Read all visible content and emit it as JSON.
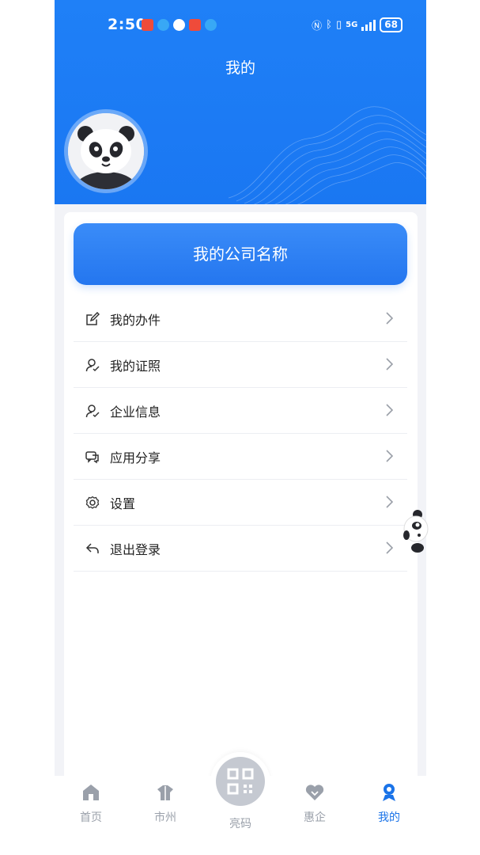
{
  "status_bar": {
    "time": "2:50",
    "network": "5G",
    "battery": "68"
  },
  "header": {
    "title": "我的"
  },
  "company": {
    "name": "我的公司名称"
  },
  "menu": {
    "items": [
      {
        "label": "我的办件",
        "icon": "edit-icon"
      },
      {
        "label": "我的证照",
        "icon": "user-icon"
      },
      {
        "label": "企业信息",
        "icon": "user-icon"
      },
      {
        "label": "应用分享",
        "icon": "chat-icon"
      },
      {
        "label": "设置",
        "icon": "gear-icon"
      },
      {
        "label": "退出登录",
        "icon": "logout-icon"
      }
    ]
  },
  "tabbar": {
    "items": [
      {
        "label": "首页",
        "icon": "home-icon",
        "active": false
      },
      {
        "label": "市州",
        "icon": "city-icon",
        "active": false
      },
      {
        "label": "亮码",
        "icon": "qrcode-icon",
        "active": false
      },
      {
        "label": "惠企",
        "icon": "heart-icon",
        "active": false
      },
      {
        "label": "我的",
        "icon": "profile-icon",
        "active": true
      }
    ]
  },
  "colors": {
    "primary": "#1a77f2",
    "inactive": "#9aa0aa",
    "active": "#1a73e8"
  }
}
